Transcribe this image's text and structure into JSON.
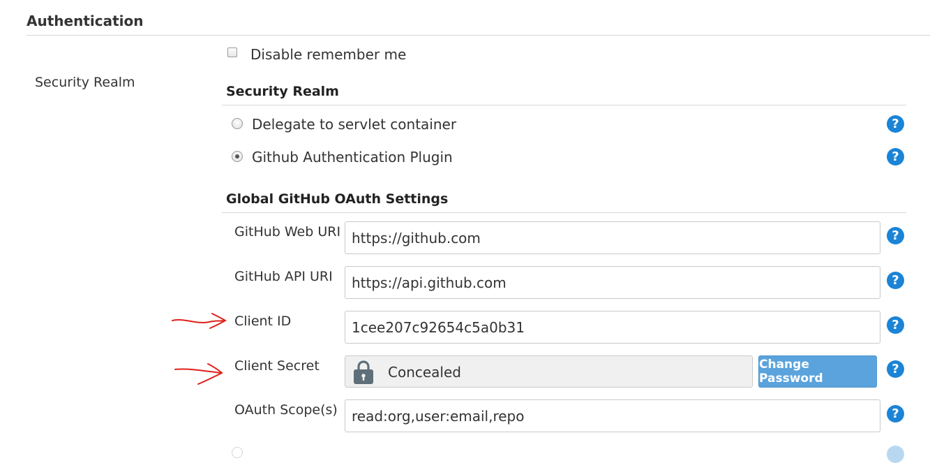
{
  "section": {
    "title": "Authentication"
  },
  "sidebar": {
    "label": "Security Realm"
  },
  "remember_me": {
    "label": "Disable remember me",
    "checked": false
  },
  "security_realm": {
    "title": "Security Realm",
    "options": [
      {
        "label": "Delegate to servlet container",
        "selected": false
      },
      {
        "label": "Github Authentication Plugin",
        "selected": true
      }
    ]
  },
  "oauth": {
    "title": "Global GitHub OAuth Settings",
    "fields": {
      "web_uri": {
        "label": "GitHub Web URI",
        "value": "https://github.com"
      },
      "api_uri": {
        "label": "GitHub API URI",
        "value": "https://api.github.com"
      },
      "client_id": {
        "label": "Client ID",
        "value": "1cee207c92654c5a0b31"
      },
      "client_secret": {
        "label": "Client Secret",
        "value": "Concealed",
        "button": "Change Password"
      },
      "scopes": {
        "label": "OAuth Scope(s)",
        "value": "read:org,user:email,repo"
      }
    }
  },
  "help": {
    "glyph": "?"
  },
  "colors": {
    "help": "#1b84d6",
    "button": "#5aa3dc",
    "annotation": "#e0201a"
  }
}
